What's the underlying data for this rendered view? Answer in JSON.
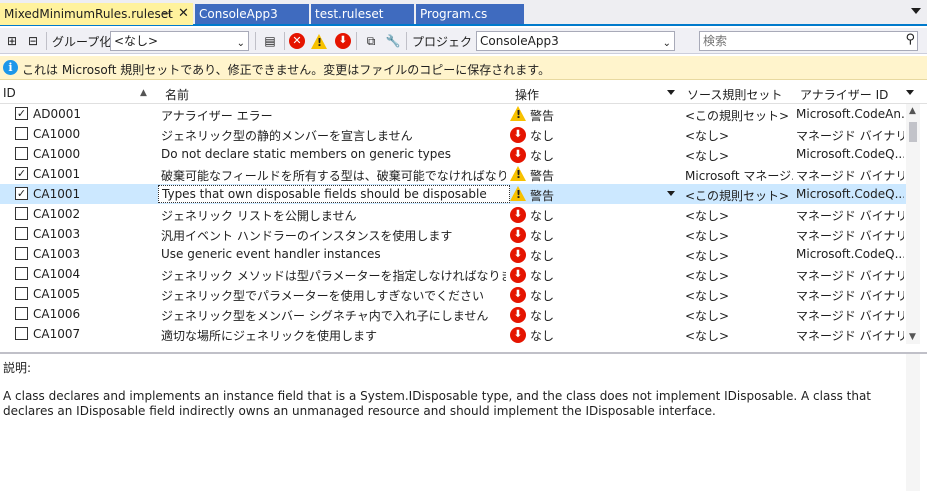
{
  "tabs": [
    {
      "label": "MixedMinimumRules.ruleset",
      "active": true
    },
    {
      "label": "ConsoleApp3"
    },
    {
      "label": "test.ruleset"
    },
    {
      "label": "Program.cs"
    }
  ],
  "toolbar": {
    "group_label": "グループ化:",
    "group_value": "<なし>",
    "project_label": "プロジェクト:",
    "project_value": "ConsoleApp3",
    "search_placeholder": "検索"
  },
  "info_bar": {
    "text": "これは Microsoft 規則セットであり、修正できません。変更はファイルのコピーに保存されます。"
  },
  "grid": {
    "columns": {
      "id": "ID",
      "name": "名前",
      "action": "操作",
      "source": "ソース規則セット",
      "analyzer": "アナライザー ID"
    },
    "rows": [
      {
        "checked": true,
        "id": "AD0001",
        "name": "アナライザー エラー",
        "action_icon": "warning-icon",
        "action": "警告",
        "source": "<この規則セット>",
        "analyzer": "Microsoft.CodeAn..."
      },
      {
        "checked": false,
        "id": "CA1000",
        "name": "ジェネリック型の静的メンバーを宣言しません",
        "action_icon": "none-icon",
        "action": "なし",
        "source": "<なし>",
        "analyzer": "マネージド バイナリ..."
      },
      {
        "checked": false,
        "id": "CA1000",
        "name": "Do not declare static members on generic types",
        "action_icon": "none-icon",
        "action": "なし",
        "source": "<なし>",
        "analyzer": "Microsoft.CodeQ..."
      },
      {
        "checked": true,
        "id": "CA1001",
        "name": "破棄可能なフィールドを所有する型は、破棄可能でなければなりません",
        "action_icon": "warning-icon",
        "action": "警告",
        "source": "Microsoft マネージ...",
        "analyzer": "マネージド バイナリ..."
      },
      {
        "checked": true,
        "id": "CA1001",
        "name": "Types that own disposable fields should be disposable",
        "action_icon": "warning-icon",
        "action": "警告",
        "source": "<この規則セット>",
        "analyzer": "Microsoft.CodeQ...",
        "selected": true
      },
      {
        "checked": false,
        "id": "CA1002",
        "name": "ジェネリック リストを公開しません",
        "action_icon": "none-icon",
        "action": "なし",
        "source": "<なし>",
        "analyzer": "マネージド バイナリ..."
      },
      {
        "checked": false,
        "id": "CA1003",
        "name": "汎用イベント ハンドラーのインスタンスを使用します",
        "action_icon": "none-icon",
        "action": "なし",
        "source": "<なし>",
        "analyzer": "マネージド バイナリ..."
      },
      {
        "checked": false,
        "id": "CA1003",
        "name": "Use generic event handler instances",
        "action_icon": "none-icon",
        "action": "なし",
        "source": "<なし>",
        "analyzer": "Microsoft.CodeQ..."
      },
      {
        "checked": false,
        "id": "CA1004",
        "name": "ジェネリック メソッドは型パラメーターを指定しなければなりません",
        "action_icon": "none-icon",
        "action": "なし",
        "source": "<なし>",
        "analyzer": "マネージド バイナリ..."
      },
      {
        "checked": false,
        "id": "CA1005",
        "name": "ジェネリック型でパラメーターを使用しすぎないでください",
        "action_icon": "none-icon",
        "action": "なし",
        "source": "<なし>",
        "analyzer": "マネージド バイナリ..."
      },
      {
        "checked": false,
        "id": "CA1006",
        "name": "ジェネリック型をメンバー シグネチャ内で入れ子にしません",
        "action_icon": "none-icon",
        "action": "なし",
        "source": "<なし>",
        "analyzer": "マネージド バイナリ..."
      },
      {
        "checked": false,
        "id": "CA1007",
        "name": "適切な場所にジェネリックを使用します",
        "action_icon": "none-icon",
        "action": "なし",
        "source": "<なし>",
        "analyzer": "マネージド バイナリ..."
      }
    ]
  },
  "description": {
    "title": "説明:",
    "body": "A class declares and implements an instance field that is a System.IDisposable type, and the class does not implement IDisposable. A class that declares an IDisposable field indirectly owns an unmanaged resource and should implement the IDisposable interface."
  },
  "colors": {
    "accent": "#007acc",
    "active_tab": "#fff29d",
    "inactive_tab": "#3f6bbf",
    "info_bar": "#fff4cc",
    "selected_row": "#cce8ff",
    "error_red": "#e51400",
    "warning_yellow": "#f7c100"
  }
}
